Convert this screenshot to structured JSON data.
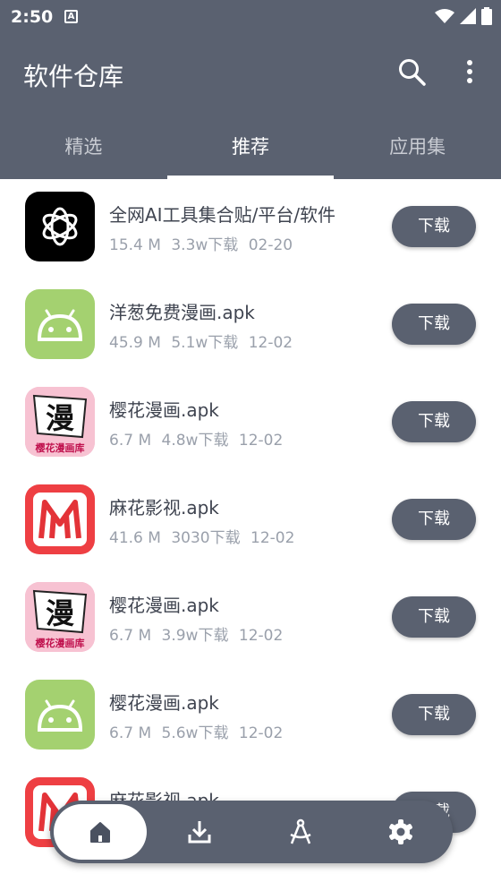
{
  "status": {
    "time": "2:50",
    "notification": "A"
  },
  "header": {
    "title": "软件仓库"
  },
  "tabs": [
    {
      "label": "精选"
    },
    {
      "label": "推荐"
    },
    {
      "label": "应用集"
    }
  ],
  "active_tab": "推荐",
  "apps": [
    {
      "name": "全网AI工具集合贴/平台/软件",
      "size": "15.4 M",
      "downloads": "3.3w下载",
      "date": "02-20",
      "icon": "openai-icon",
      "button": "下载"
    },
    {
      "name": "洋葱免费漫画.apk",
      "size": "45.9 M",
      "downloads": "5.1w下载",
      "date": "12-02",
      "icon": "android-icon",
      "button": "下载"
    },
    {
      "name": "樱花漫画.apk",
      "size": "6.7 M",
      "downloads": "4.8w下载",
      "date": "12-02",
      "icon": "sakura-manga-icon",
      "icon_text": "漫",
      "icon_caption": "樱花漫画库",
      "button": "下载"
    },
    {
      "name": "麻花影视.apk",
      "size": "41.6 M",
      "downloads": "3030下载",
      "date": "12-02",
      "icon": "mahua-icon",
      "button": "下载"
    },
    {
      "name": "樱花漫画.apk",
      "size": "6.7 M",
      "downloads": "3.9w下载",
      "date": "12-02",
      "icon": "sakura-manga-icon",
      "icon_text": "漫",
      "icon_caption": "樱花漫画库",
      "button": "下载"
    },
    {
      "name": "樱花漫画.apk",
      "size": "6.7 M",
      "downloads": "5.6w下载",
      "date": "12-02",
      "icon": "android-icon",
      "button": "下载"
    },
    {
      "name": "麻花影视.apk",
      "size": "",
      "downloads": "",
      "date": "",
      "icon": "mahua-icon",
      "button": "下载"
    }
  ],
  "bottom_nav": [
    {
      "icon": "home-icon",
      "active": true
    },
    {
      "icon": "download-icon",
      "active": false
    },
    {
      "icon": "compass-tool-icon",
      "active": false
    },
    {
      "icon": "settings-icon",
      "active": false
    }
  ],
  "colors": {
    "primary": "#5a6170",
    "text": "#3f4450",
    "meta": "#9aa0ab",
    "android": "#a4d170",
    "mahua": "#ee3f43",
    "sakura": "#f5b5c8"
  }
}
